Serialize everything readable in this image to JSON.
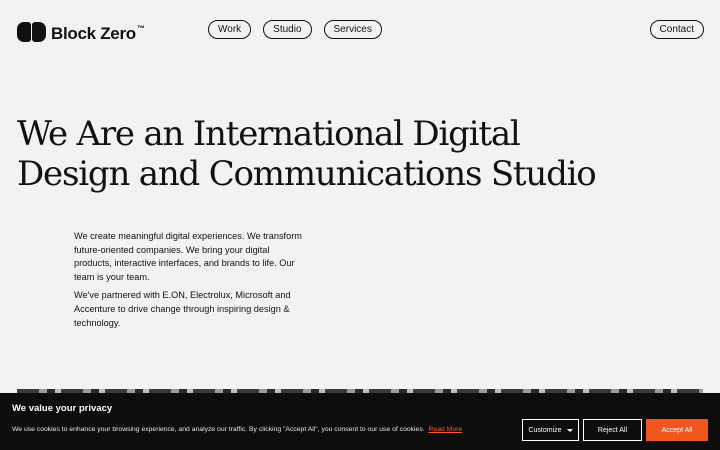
{
  "brand": {
    "name": "Block Zero",
    "trademark": "™"
  },
  "nav": {
    "items": [
      {
        "label": "Work"
      },
      {
        "label": "Studio"
      },
      {
        "label": "Services"
      }
    ],
    "contact_label": "Contact"
  },
  "hero": {
    "title": "We Are an International Digital Design and Communications Studio",
    "intro_1": "We create meaningful digital experiences. We transform future-oriented companies. We bring your digital products, interactive interfaces, and brands to life. Our team is your team.",
    "intro_2": "We've partnered with E.ON, Electrolux, Microsoft and Accenture to drive change through inspiring design & technology."
  },
  "cookie": {
    "title": "We value your privacy",
    "text": "We use cookies to enhance your browsing experience, and analyze our traffic. By clicking \"Accept All\", you consent to our use of cookies.",
    "read_more": "Read More",
    "customize_label": "Customize",
    "reject_label": "Reject All",
    "accept_label": "Accept All",
    "accent_color": "#f2561f"
  },
  "icons": {
    "logo": "block-zero-logo-icon",
    "customize_caret": "caret-down-icon"
  }
}
